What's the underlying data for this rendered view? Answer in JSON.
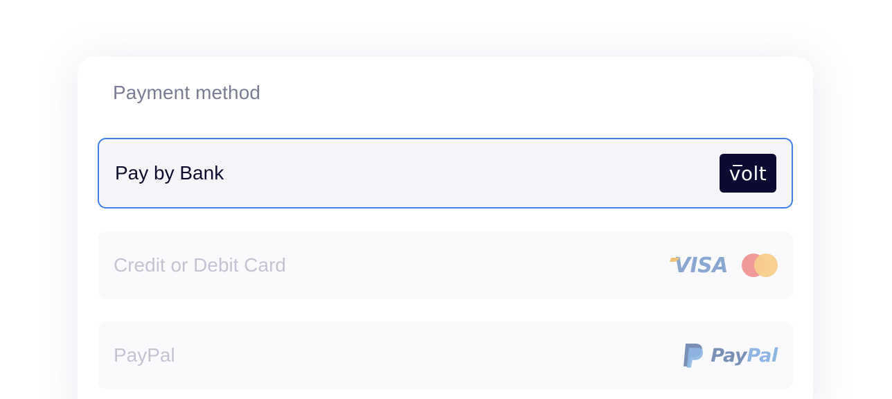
{
  "payment": {
    "title": "Payment method",
    "options": [
      {
        "label": "Pay by Bank",
        "state": "selected",
        "brand": "Volt",
        "brand_icon": "volt-logo-icon"
      },
      {
        "label": "Credit or Debit Card",
        "state": "unselected",
        "brands": [
          "VISA",
          "Mastercard"
        ],
        "brand_icons": [
          "visa-logo-icon",
          "mastercard-logo-icon"
        ]
      },
      {
        "label": "PayPal",
        "state": "unselected",
        "brand": "PayPal",
        "brand_icon": "paypal-logo-icon"
      }
    ]
  },
  "logos": {
    "volt_text": "volt",
    "visa_text": "VISA",
    "paypal_part1": "Pay",
    "paypal_part2": "Pal"
  },
  "colors": {
    "accent_border": "#3f7fe6",
    "selected_bg": "#f4f4f9",
    "volt_bg": "#0b0a33",
    "muted_text": "#c3c4d2",
    "title_text": "#7a7d93"
  }
}
